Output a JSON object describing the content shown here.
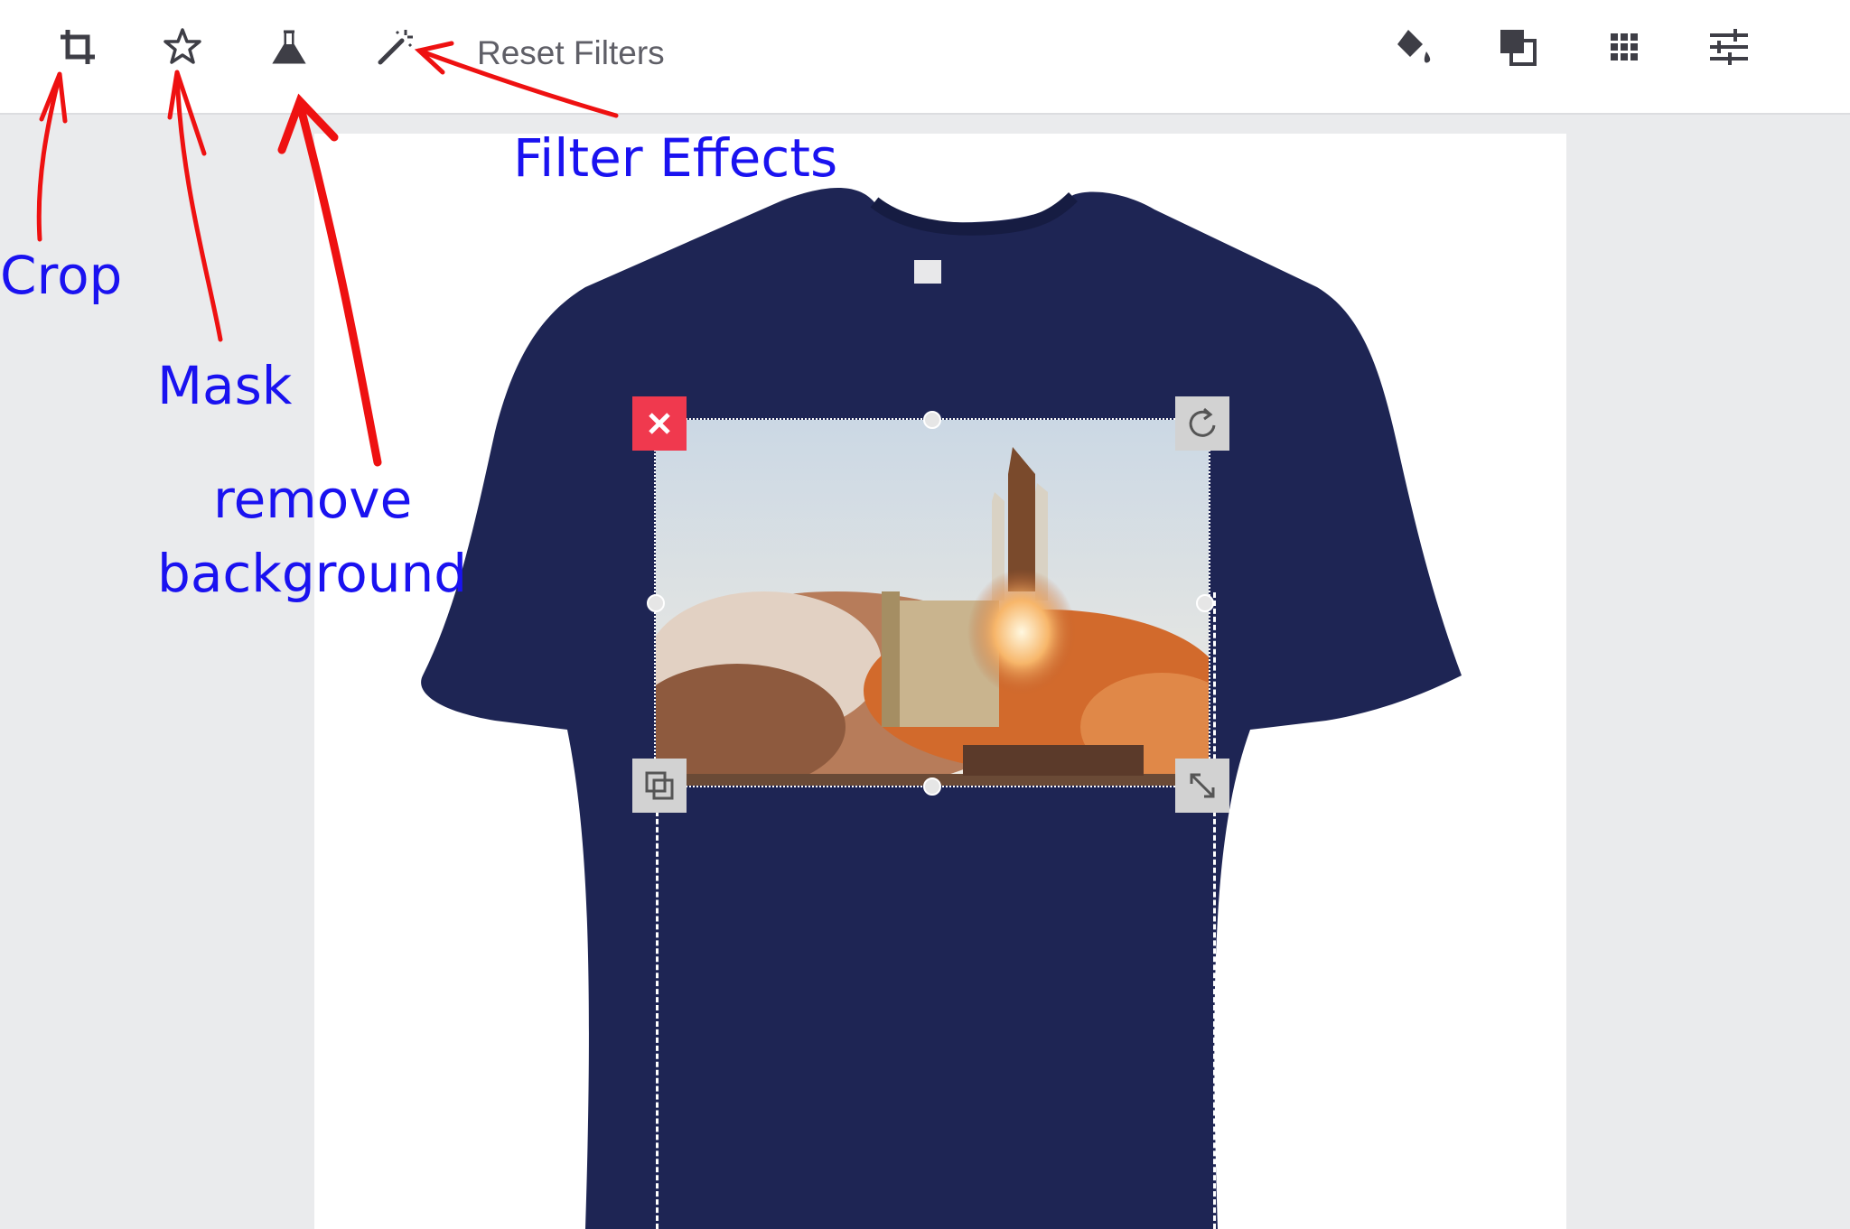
{
  "toolbar": {
    "left_tools": [
      {
        "name": "crop-icon"
      },
      {
        "name": "star-icon"
      },
      {
        "name": "flask-icon"
      },
      {
        "name": "magic-wand-icon"
      }
    ],
    "reset_filters_label": "Reset Filters",
    "right_tools": [
      {
        "name": "paint-bucket-icon"
      },
      {
        "name": "layers-icon"
      },
      {
        "name": "grid-icon"
      },
      {
        "name": "sliders-icon"
      }
    ]
  },
  "canvas": {
    "product": "navy t-shirt",
    "shirt_color": "#1e2554",
    "image_subject": "space shuttle launch"
  },
  "selection_controls": [
    {
      "name": "delete-icon",
      "color": "#f0394e"
    },
    {
      "name": "rotate-icon"
    },
    {
      "name": "duplicate-icon"
    },
    {
      "name": "resize-icon"
    }
  ],
  "annotations": {
    "crop": "Crop",
    "mask": "Mask",
    "remove_line1": "remove",
    "remove_line2": "background",
    "filter_effects": "Filter Effects",
    "color": "#1a12f0",
    "arrow_color": "#ee1111"
  }
}
